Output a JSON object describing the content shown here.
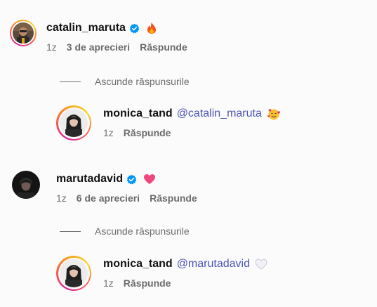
{
  "comments": [
    {
      "username": "catalin_maruta",
      "verified": true,
      "text_emoji": "fire",
      "time": "1z",
      "likes": "3 de aprecieri",
      "reply": "Răspunde",
      "toggle_replies": "Ascunde răspunsurile",
      "replies": [
        {
          "username": "monica_tand",
          "mention": "@catalin_maruta",
          "text_emoji": "smiling-face-with-hearts",
          "time": "1z",
          "reply": "Răspunde"
        }
      ]
    },
    {
      "username": "marutadavid",
      "verified": true,
      "text_emoji": "pink-heart",
      "time": "1z",
      "likes": "6 de aprecieri",
      "reply": "Răspunde",
      "toggle_replies": "Ascunde răspunsurile",
      "replies": [
        {
          "username": "monica_tand",
          "mention": "@marutadavid",
          "text_emoji": "white-heart",
          "time": "1z",
          "reply": "Răspunde"
        }
      ]
    }
  ],
  "colors": {
    "mention": "#4d54b5",
    "verified": "#0095f6",
    "meta": "#737373"
  }
}
